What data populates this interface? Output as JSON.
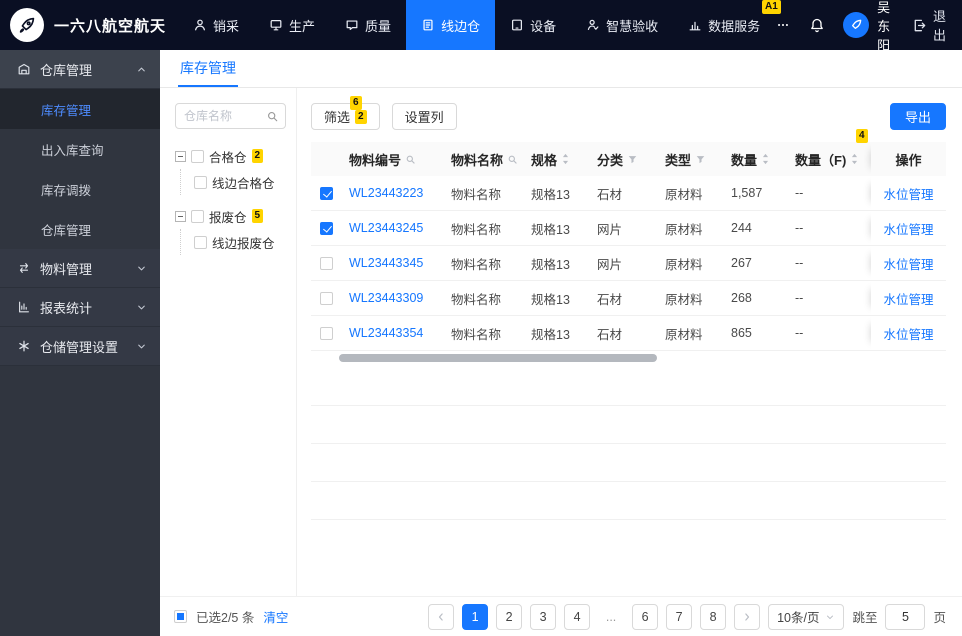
{
  "topnav": {
    "brand": "一六八航空航天",
    "items": [
      {
        "label": "销采",
        "icon": "user-icon"
      },
      {
        "label": "生产",
        "icon": "production-icon"
      },
      {
        "label": "质量",
        "icon": "quality-icon"
      },
      {
        "label": "线边仓",
        "icon": "lineside-warehouse-icon",
        "active": true
      },
      {
        "label": "设备",
        "icon": "device-icon"
      },
      {
        "label": "智慧验收",
        "icon": "smart-acceptance-icon"
      },
      {
        "label": "数据服务",
        "icon": "data-service-icon"
      }
    ],
    "user_name": "吴东阳",
    "logout_label": "退出"
  },
  "sidebar": {
    "groups": [
      {
        "label": "仓库管理",
        "icon": "warehouse-icon",
        "expanded": true,
        "children": [
          {
            "label": "库存管理",
            "active": true
          },
          {
            "label": "出入库查询"
          },
          {
            "label": "库存调拨"
          },
          {
            "label": "仓库管理"
          }
        ]
      },
      {
        "label": "物料管理",
        "icon": "material-icon",
        "expanded": false
      },
      {
        "label": "报表统计",
        "icon": "report-icon",
        "expanded": false
      },
      {
        "label": "仓储管理设置",
        "icon": "storage-settings-icon",
        "expanded": false
      }
    ]
  },
  "main": {
    "tab_label": "库存管理",
    "tree_panel": {
      "search_placeholder": "仓库名称",
      "nodes": [
        {
          "label": "合格仓",
          "mark": "2",
          "checked": false,
          "children": [
            {
              "label": "线边合格仓",
              "checked": false
            }
          ]
        },
        {
          "label": "报废仓",
          "mark": "5",
          "checked": false,
          "children": [
            {
              "label": "线边报废仓",
              "checked": false
            }
          ]
        }
      ]
    },
    "toolbar": {
      "filter_label": "筛选",
      "filter_count": "2",
      "columns_label": "设置列",
      "export_label": "导出"
    },
    "table": {
      "headers": [
        "物料编号",
        "物料名称",
        "规格",
        "分类",
        "类型",
        "数量",
        "数量（F)",
        "操作"
      ],
      "rows": [
        {
          "checked": true,
          "code": "WL23443223",
          "name": "物料名称",
          "spec": "规格13",
          "category": "石材",
          "type": "原材料",
          "qty": "1,587",
          "qty_f": "--",
          "action": "水位管理"
        },
        {
          "checked": true,
          "code": "WL23443245",
          "name": "物料名称",
          "spec": "规格13",
          "category": "网片",
          "type": "原材料",
          "qty": "244",
          "qty_f": "--",
          "action": "水位管理"
        },
        {
          "checked": false,
          "code": "WL23443345",
          "name": "物料名称",
          "spec": "规格13",
          "category": "网片",
          "type": "原材料",
          "qty": "267",
          "qty_f": "--",
          "action": "水位管理"
        },
        {
          "checked": false,
          "code": "WL23443309",
          "name": "物料名称",
          "spec": "规格13",
          "category": "石材",
          "type": "原材料",
          "qty": "268",
          "qty_f": "--",
          "action": "水位管理"
        },
        {
          "checked": false,
          "code": "WL23443354",
          "name": "物料名称",
          "spec": "规格13",
          "category": "石材",
          "type": "原材料",
          "qty": "865",
          "qty_f": "--",
          "action": "水位管理"
        }
      ]
    }
  },
  "footer": {
    "selected_text": "已选2/5 条",
    "clear_label": "清空",
    "pages": [
      "1",
      "2",
      "3",
      "4",
      "...",
      "6",
      "7",
      "8"
    ],
    "active_page": "1",
    "page_size": "10条/页",
    "jump_label": "跳至",
    "jump_value": "5",
    "jump_unit": "页"
  },
  "marks": [
    {
      "label": "A1"
    },
    {
      "label": "6"
    },
    {
      "label": "4"
    }
  ],
  "colors": {
    "accent": "#1677ff",
    "topnav_bg": "#0a0f23",
    "sidebar_bg": "#30353f",
    "mark_bg": "#ffd400",
    "link": "#1677ff"
  }
}
